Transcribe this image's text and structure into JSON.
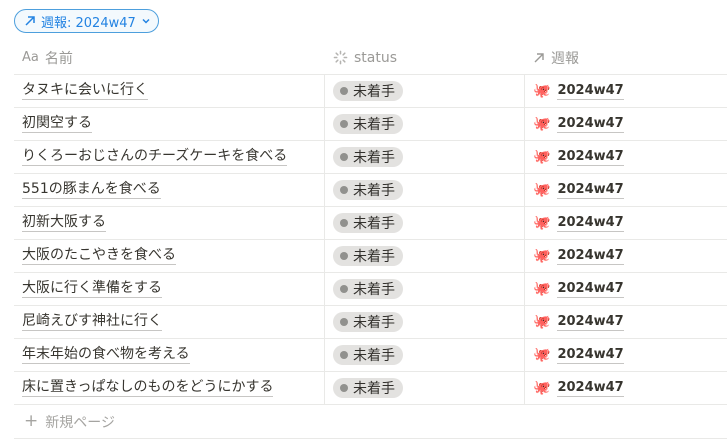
{
  "filter": {
    "label": "週報: 2024w47",
    "arrow_icon": "arrow-up-right-icon",
    "chevron_icon": "chevron-down-icon",
    "accent_color": "#2383e2"
  },
  "columns": {
    "name": {
      "icon": "Aa",
      "label": "名前"
    },
    "status": {
      "icon": "status-spinner-icon",
      "label": "status"
    },
    "week": {
      "icon": "arrow-up-right-icon",
      "label": "週報"
    }
  },
  "rows": [
    {
      "name": "タヌキに会いに行く",
      "status": "未着手",
      "week": "2024w47"
    },
    {
      "name": "初関空する",
      "status": "未着手",
      "week": "2024w47"
    },
    {
      "name": "りくろーおじさんのチーズケーキを食べる",
      "status": "未着手",
      "week": "2024w47"
    },
    {
      "name": "551の豚まんを食べる",
      "status": "未着手",
      "week": "2024w47"
    },
    {
      "name": "初新大阪する",
      "status": "未着手",
      "week": "2024w47"
    },
    {
      "name": "大阪のたこやきを食べる",
      "status": "未着手",
      "week": "2024w47"
    },
    {
      "name": "大阪に行く準備をする",
      "status": "未着手",
      "week": "2024w47"
    },
    {
      "name": "尼崎えびす神社に行く",
      "status": "未着手",
      "week": "2024w47"
    },
    {
      "name": "年末年始の食べ物を考える",
      "status": "未着手",
      "week": "2024w47"
    },
    {
      "name": "床に置きっぱなしのものをどうにかする",
      "status": "未着手",
      "week": "2024w47"
    }
  ],
  "week_icon": "octopus-icon",
  "new_page": {
    "label": "新規ページ"
  }
}
